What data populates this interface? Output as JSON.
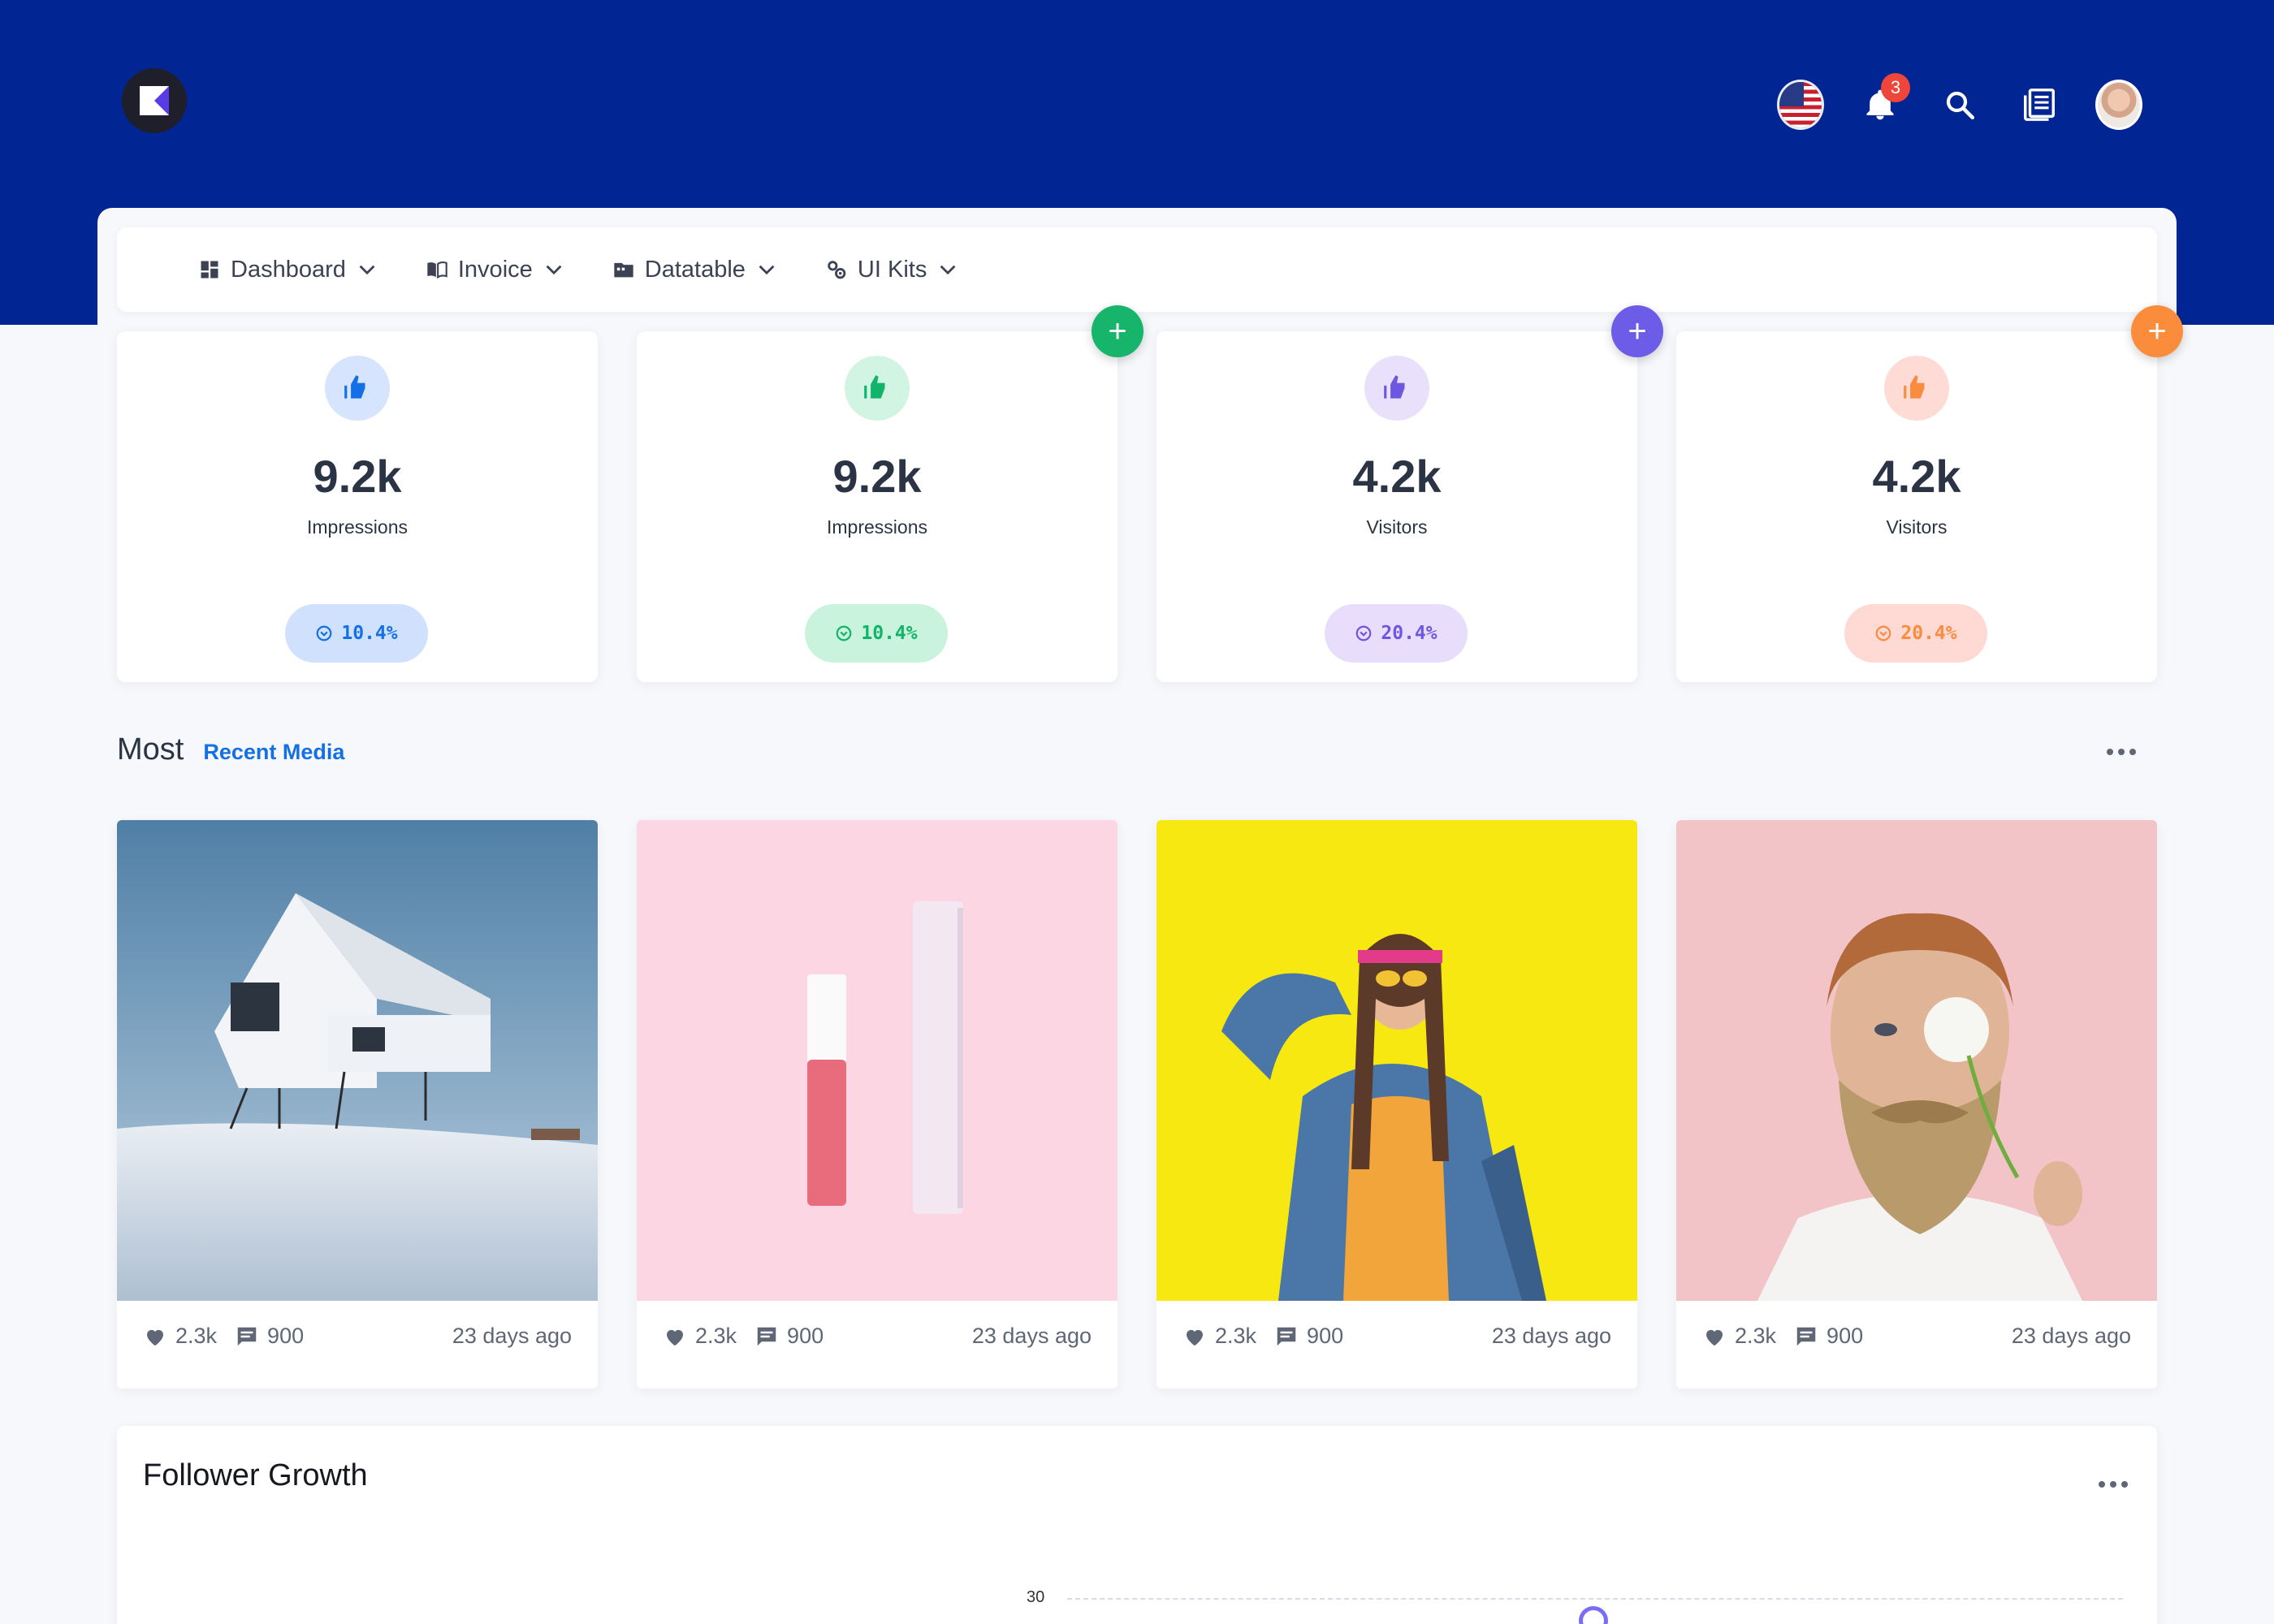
{
  "header": {
    "notifications_count": "3"
  },
  "nav": {
    "items": [
      {
        "label": "Dashboard"
      },
      {
        "label": "Invoice"
      },
      {
        "label": "Datatable"
      },
      {
        "label": "UI Kits"
      }
    ]
  },
  "stats": [
    {
      "value": "9.2k",
      "label": "Impressions",
      "change": "10.4%",
      "color": "#1570e6",
      "bg": "#cfe1fd",
      "icon_bg": "#d6e5fd",
      "fab": null
    },
    {
      "value": "9.2k",
      "label": "Impressions",
      "change": "10.4%",
      "color": "#12b36a",
      "bg": "#c9f3dc",
      "icon_bg": "#d2f4e2",
      "fab": "#17b56b"
    },
    {
      "value": "4.2k",
      "label": "Visitors",
      "change": "20.4%",
      "color": "#6e57e0",
      "bg": "#e8ddfb",
      "icon_bg": "#e9e0fb",
      "fab": "#6c5ce7"
    },
    {
      "value": "4.2k",
      "label": "Visitors",
      "change": "20.4%",
      "color": "#fb8b3e",
      "bg": "#ffd9d3",
      "icon_bg": "#ffdbd5",
      "fab": "#fb8c3c"
    }
  ],
  "media_section": {
    "title": "Most",
    "subtitle": "Recent Media"
  },
  "media": [
    {
      "likes": "2.3k",
      "comments": "900",
      "date": "23 days ago",
      "subject": "house-in-snow"
    },
    {
      "likes": "2.3k",
      "comments": "900",
      "date": "23 days ago",
      "subject": "cosmetics-on-pink"
    },
    {
      "likes": "2.3k",
      "comments": "900",
      "date": "23 days ago",
      "subject": "woman-with-headphones"
    },
    {
      "likes": "2.3k",
      "comments": "900",
      "date": "23 days ago",
      "subject": "bearded-man-with-dandelion"
    }
  ],
  "growth": {
    "title": "Follower Growth"
  },
  "chart_data": {
    "type": "line",
    "title": "Follower Growth",
    "ytick_labels": [
      "30"
    ]
  },
  "colors": {
    "header_bg": "#012693",
    "accent": "#1570e6"
  }
}
